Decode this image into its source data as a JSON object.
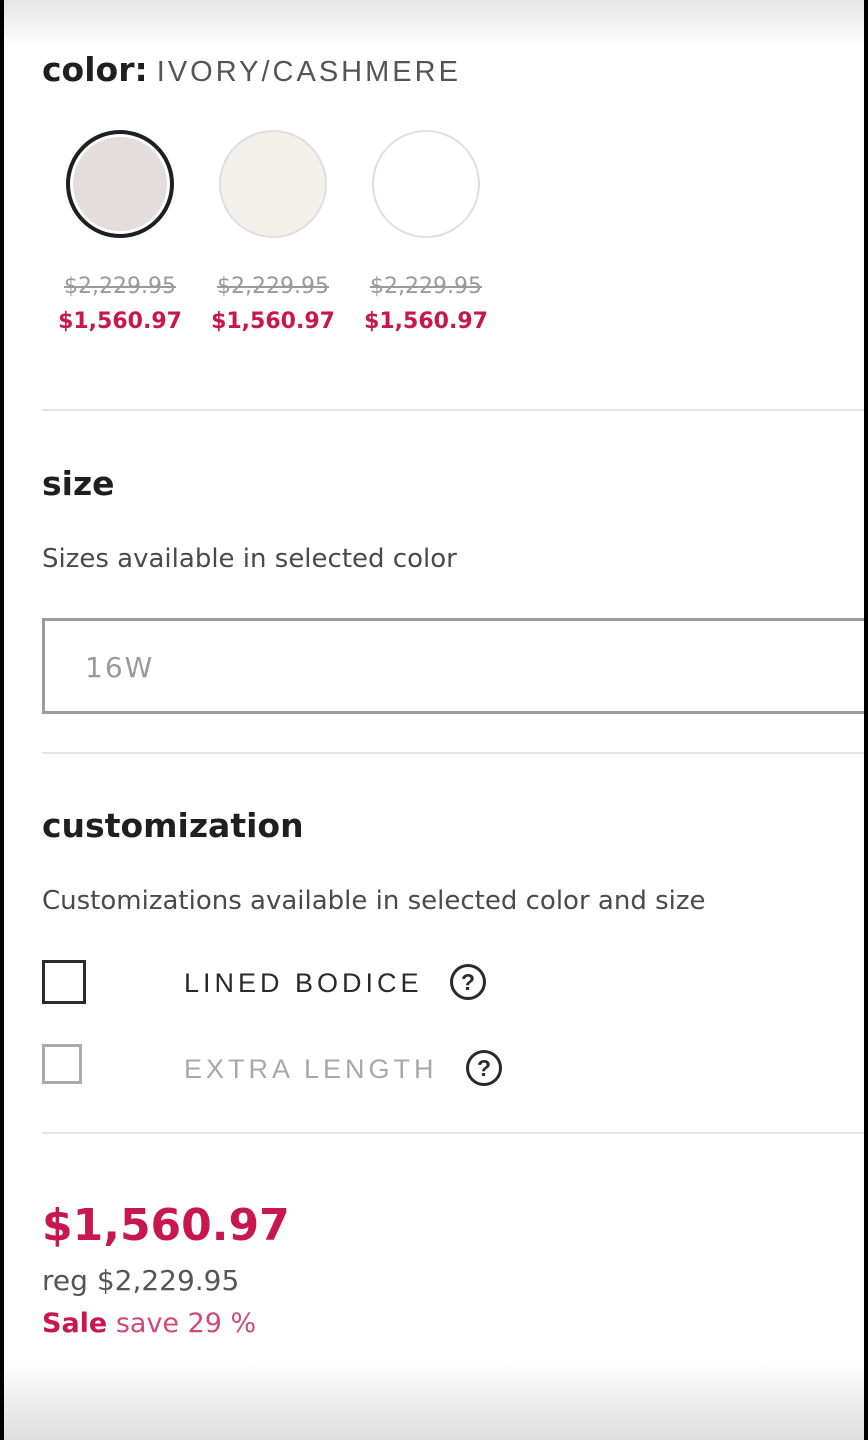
{
  "colors": {
    "accent": "#c8174f",
    "text": "#1f1f1f",
    "muted": "#9a9a9a"
  },
  "color_section": {
    "label": "color:",
    "selected_value": "IVORY/CASHMERE",
    "swatches": [
      {
        "fill": "#e4dbdb",
        "reg_price": "$2,229.95",
        "sale_price": "$1,560.97",
        "selected": true
      },
      {
        "fill": "#f1f1ea",
        "reg_price": "$2,229.95",
        "sale_price": "$1,560.97",
        "selected": false
      },
      {
        "fill": "#ffffff",
        "reg_price": "$2,229.95",
        "sale_price": "$1,560.97",
        "selected": false
      }
    ]
  },
  "size_section": {
    "title": "size",
    "subtitle": "Sizes available in selected color",
    "selected_size": "16W"
  },
  "customization_section": {
    "title": "customization",
    "subtitle": "Customizations available in selected color and size",
    "options": [
      {
        "label": "LINED BODICE",
        "checked": false,
        "enabled": true,
        "help_icon": "question-circle-icon"
      },
      {
        "label": "EXTRA LENGTH",
        "checked": false,
        "enabled": false,
        "help_icon": "question-circle-icon"
      }
    ]
  },
  "pricing": {
    "sale_price": "$1,560.97",
    "reg_label": "reg",
    "reg_price": "$2,229.95",
    "sale_word": "Sale",
    "save_text": "save 29 %"
  }
}
